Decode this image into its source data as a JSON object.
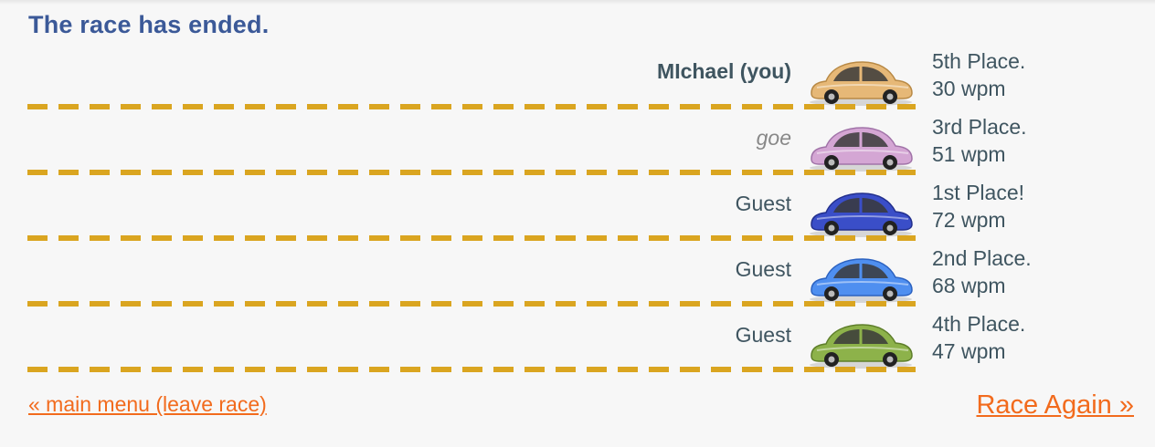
{
  "status": {
    "title": "The race has ended."
  },
  "lanes": [
    {
      "name": "MIchael (you)",
      "place": "5th Place.",
      "wpm": "30 wpm",
      "car_color": "#e6b877",
      "car_dark": "#b88945",
      "name_style": "you"
    },
    {
      "name": "goe",
      "place": "3rd Place.",
      "wpm": "51 wpm",
      "car_color": "#d4a6d4",
      "car_dark": "#a173a8",
      "name_style": "italic"
    },
    {
      "name": "Guest",
      "place": "1st Place!",
      "wpm": "72 wpm",
      "car_color": "#3a4ec8",
      "car_dark": "#222f8c",
      "name_style": "normal"
    },
    {
      "name": "Guest",
      "place": "2nd Place.",
      "wpm": "68 wpm",
      "car_color": "#4f8ff0",
      "car_dark": "#2c62c0",
      "name_style": "normal"
    },
    {
      "name": "Guest",
      "place": "4th Place.",
      "wpm": "47 wpm",
      "car_color": "#8db24a",
      "car_dark": "#5e7e2a",
      "name_style": "normal"
    }
  ],
  "footer": {
    "leave_label": "« main menu (leave race)",
    "again_label": "Race Again »"
  },
  "colors": {
    "title": "#3b5998",
    "link": "#f26b1d",
    "lane_line": "#daa520"
  }
}
